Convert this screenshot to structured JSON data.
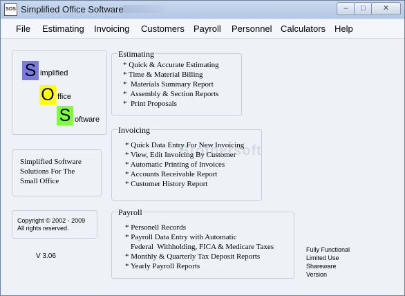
{
  "window": {
    "title": "Simplified Office Software",
    "icon_text": "SOS",
    "controls": {
      "minimize": "–",
      "maximize": "□",
      "close": "✕"
    }
  },
  "menu": [
    "File",
    "Estimating",
    "Invoicing",
    "Customers",
    "Payroll",
    "Personnel",
    "Calculators",
    "Help"
  ],
  "logo": {
    "letters": [
      "S",
      "O",
      "S"
    ],
    "words": [
      "implified",
      "ffice",
      "oftware"
    ],
    "colors": [
      "#7b7bdf",
      "#ffff00",
      "#7cff3a"
    ]
  },
  "tagline": "Simplified Software\nSolutions For The\nSmall Office",
  "copyright": "Copyright © 2002 - 2009\nAll rights reserved.",
  "version": "V 3.06",
  "license_note": "Fully Functional\nLimited Use\nShareware\nVersion",
  "sections": {
    "estimating": {
      "title": "Estimating",
      "items": [
        "* Quick & Accurate Estimating",
        "* Time & Material Billing",
        "*  Materials Summary Report",
        "*  Assembly & Section Reports",
        "*  Print Proposals"
      ]
    },
    "invoicing": {
      "title": "Invoicing",
      "items": [
        "* Quick Data Entry For New Invoicing",
        "* View, Edit Invoicing By Customer",
        "* Automatic Printing of Invoices",
        "* Accounts Receivable Report",
        "* Customer History Report"
      ]
    },
    "payroll": {
      "title": "Payroll",
      "items": [
        "* Personell Records",
        "* Payroll Data Entry with Automatic",
        "Federal  Withholding, FICA & Medicare Taxes",
        "* Monthly & Quarterly Tax Deposit Reports",
        "* Yearly Payroll Reports"
      ]
    }
  }
}
